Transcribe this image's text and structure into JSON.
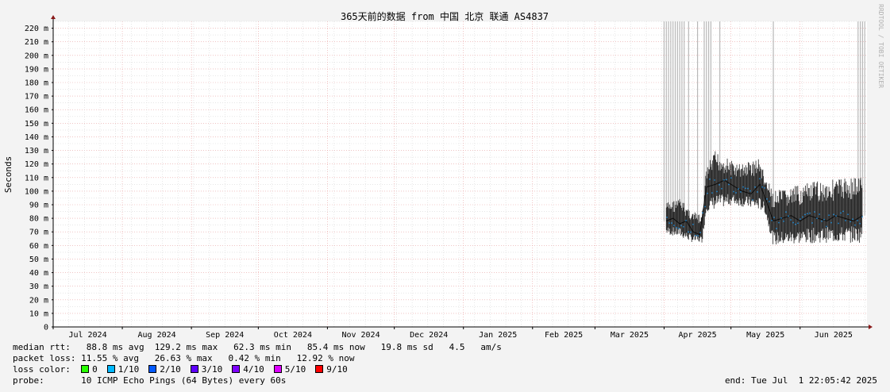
{
  "chart_data": {
    "type": "line",
    "title": "365天前的数据 from 中国 北京 联通 AS4837",
    "ylabel": "Seconds",
    "xlabel": "",
    "ylim": [
      0,
      225
    ],
    "y_ticks": [
      {
        "v": 0,
        "label": "0"
      },
      {
        "v": 10,
        "label": "10 m"
      },
      {
        "v": 20,
        "label": "20 m"
      },
      {
        "v": 30,
        "label": "30 m"
      },
      {
        "v": 40,
        "label": "40 m"
      },
      {
        "v": 50,
        "label": "50 m"
      },
      {
        "v": 60,
        "label": "60 m"
      },
      {
        "v": 70,
        "label": "70 m"
      },
      {
        "v": 80,
        "label": "80 m"
      },
      {
        "v": 90,
        "label": "90 m"
      },
      {
        "v": 100,
        "label": "100 m"
      },
      {
        "v": 110,
        "label": "110 m"
      },
      {
        "v": 120,
        "label": "120 m"
      },
      {
        "v": 130,
        "label": "130 m"
      },
      {
        "v": 140,
        "label": "140 m"
      },
      {
        "v": 150,
        "label": "150 m"
      },
      {
        "v": 160,
        "label": "160 m"
      },
      {
        "v": 170,
        "label": "170 m"
      },
      {
        "v": 180,
        "label": "180 m"
      },
      {
        "v": 190,
        "label": "190 m"
      },
      {
        "v": 200,
        "label": "200 m"
      },
      {
        "v": 210,
        "label": "210 m"
      },
      {
        "v": 220,
        "label": "220 m"
      }
    ],
    "x_range": [
      "2024-07-01",
      "2025-07-01"
    ],
    "x_ticks": [
      {
        "date": "2024-07-01",
        "label": "Jul 2024"
      },
      {
        "date": "2024-08-01",
        "label": "Aug 2024"
      },
      {
        "date": "2024-09-01",
        "label": "Sep 2024"
      },
      {
        "date": "2024-10-01",
        "label": "Oct 2024"
      },
      {
        "date": "2024-11-01",
        "label": "Nov 2024"
      },
      {
        "date": "2024-12-01",
        "label": "Dec 2024"
      },
      {
        "date": "2025-01-01",
        "label": "Jan 2025"
      },
      {
        "date": "2025-02-01",
        "label": "Feb 2025"
      },
      {
        "date": "2025-03-01",
        "label": "Mar 2025"
      },
      {
        "date": "2025-04-01",
        "label": "Apr 2025"
      },
      {
        "date": "2025-05-01",
        "label": "May 2025"
      },
      {
        "date": "2025-06-01",
        "label": "Jun 2025"
      }
    ],
    "grid": true,
    "series": [
      {
        "median": [
          {
            "date": "2025-04-02",
            "v": 78
          },
          {
            "date": "2025-04-05",
            "v": 80
          },
          {
            "date": "2025-04-08",
            "v": 76
          },
          {
            "date": "2025-04-11",
            "v": 78
          },
          {
            "date": "2025-04-14",
            "v": 70
          },
          {
            "date": "2025-04-17",
            "v": 68
          },
          {
            "date": "2025-04-20",
            "v": 103
          },
          {
            "date": "2025-04-24",
            "v": 105
          },
          {
            "date": "2025-04-28",
            "v": 108
          },
          {
            "date": "2025-05-02",
            "v": 104
          },
          {
            "date": "2025-05-06",
            "v": 100
          },
          {
            "date": "2025-05-10",
            "v": 98
          },
          {
            "date": "2025-05-14",
            "v": 105
          },
          {
            "date": "2025-05-17",
            "v": 92
          },
          {
            "date": "2025-05-20",
            "v": 78
          },
          {
            "date": "2025-05-24",
            "v": 80
          },
          {
            "date": "2025-05-28",
            "v": 82
          },
          {
            "date": "2025-06-01",
            "v": 78
          },
          {
            "date": "2025-06-05",
            "v": 82
          },
          {
            "date": "2025-06-09",
            "v": 80
          },
          {
            "date": "2025-06-13",
            "v": 78
          },
          {
            "date": "2025-06-17",
            "v": 82
          },
          {
            "date": "2025-06-21",
            "v": 80
          },
          {
            "date": "2025-06-25",
            "v": 78
          },
          {
            "date": "2025-06-29",
            "v": 82
          }
        ],
        "low": [
          {
            "date": "2025-04-02",
            "v": 68
          },
          {
            "date": "2025-04-08",
            "v": 66
          },
          {
            "date": "2025-04-14",
            "v": 62
          },
          {
            "date": "2025-04-18",
            "v": 62
          },
          {
            "date": "2025-04-20",
            "v": 85
          },
          {
            "date": "2025-05-02",
            "v": 90
          },
          {
            "date": "2025-05-16",
            "v": 85
          },
          {
            "date": "2025-05-20",
            "v": 60
          },
          {
            "date": "2025-06-10",
            "v": 62
          },
          {
            "date": "2025-06-29",
            "v": 62
          }
        ],
        "high": [
          {
            "date": "2025-04-02",
            "v": 92
          },
          {
            "date": "2025-04-08",
            "v": 95
          },
          {
            "date": "2025-04-14",
            "v": 85
          },
          {
            "date": "2025-04-18",
            "v": 82
          },
          {
            "date": "2025-04-20",
            "v": 118
          },
          {
            "date": "2025-04-24",
            "v": 130
          },
          {
            "date": "2025-05-04",
            "v": 120
          },
          {
            "date": "2025-05-14",
            "v": 125
          },
          {
            "date": "2025-05-16",
            "v": 112
          },
          {
            "date": "2025-05-20",
            "v": 100
          },
          {
            "date": "2025-06-10",
            "v": 108
          },
          {
            "date": "2025-06-29",
            "v": 112
          }
        ],
        "loss_spikes": [
          "2025-04-01",
          "2025-04-02",
          "2025-04-03",
          "2025-04-04",
          "2025-04-05",
          "2025-04-06",
          "2025-04-07",
          "2025-04-08",
          "2025-04-09",
          "2025-04-10",
          "2025-04-12",
          "2025-04-16",
          "2025-04-19",
          "2025-04-20",
          "2025-04-21",
          "2025-04-22",
          "2025-04-26",
          "2025-05-20",
          "2025-06-27",
          "2025-06-28",
          "2025-06-29",
          "2025-06-30"
        ]
      }
    ]
  },
  "watermark": "RRDTOOL / TOBI OETIKER",
  "stats": {
    "median_rtt": "median rtt:   88.8 ms avg  129.2 ms max   62.3 ms min   85.4 ms now   19.8 ms sd   4.5   am/s",
    "packet_loss": "packet loss: 11.55 % avg   26.63 % max   0.42 % min   12.92 % now",
    "loss_color_label": "loss color:  ",
    "loss_colors": [
      {
        "label": "0",
        "color": "#26ff00"
      },
      {
        "label": "1/10",
        "color": "#00b8ff"
      },
      {
        "label": "2/10",
        "color": "#0059ff"
      },
      {
        "label": "3/10",
        "color": "#5e00ff"
      },
      {
        "label": "4/10",
        "color": "#7e00ff"
      },
      {
        "label": "5/10",
        "color": "#dd00ff"
      },
      {
        "label": "9/10",
        "color": "#ff0000"
      }
    ],
    "probe": "probe:       10 ICMP Echo Pings (64 Bytes) every 60s",
    "end": "end: Tue Jul  1 22:05:42 2025"
  },
  "colors": {
    "background": "#f3f3f3",
    "plot_bg": "#ffffff",
    "grid_minor": "#d8d8d8",
    "grid_major": "#e8a0a0",
    "median": "#0a0a0a",
    "smoke": "#222222",
    "spike": "#b8b8b8",
    "avg_dots": "#1f8bd6",
    "axis": "#000000",
    "arrow": "#8a1a1a"
  }
}
